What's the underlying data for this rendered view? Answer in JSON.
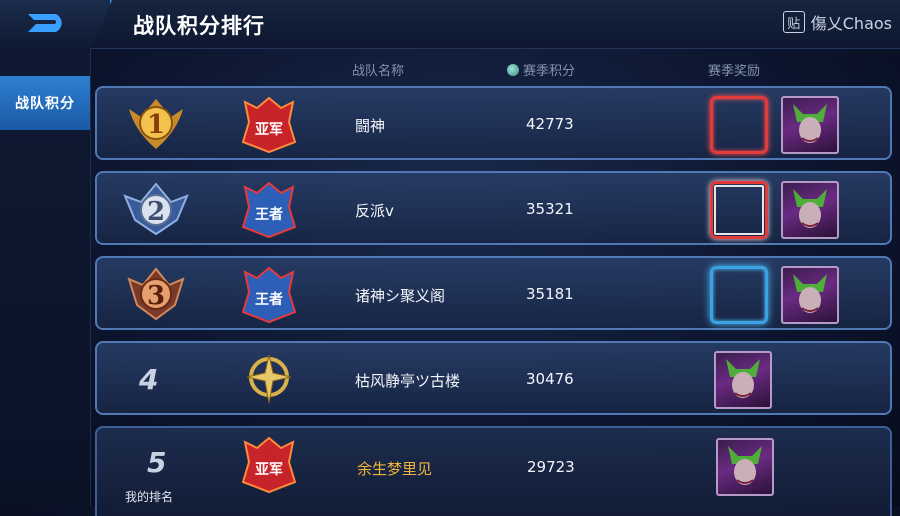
{
  "header": {
    "title": "战队积分排行",
    "brand_glyph": "贴",
    "brand_text": "傷乂Chaos"
  },
  "sidebar": {
    "tab_label": "战队积分"
  },
  "columns": {
    "name": "战队名称",
    "score": "赛季积分",
    "reward": "赛季奖励"
  },
  "rows": [
    {
      "rank": "1",
      "badge": "亚军",
      "name": "闘神",
      "score": "42773",
      "frame": "red"
    },
    {
      "rank": "2",
      "badge": "王者",
      "name": "反派v",
      "score": "35321",
      "frame": "silver"
    },
    {
      "rank": "3",
      "badge": "王者",
      "name": "诸神シ聚义阁",
      "score": "35181",
      "frame": "blue"
    },
    {
      "rank": "4",
      "badge": "",
      "name": "枯风静亭ツ古楼",
      "score": "30476",
      "frame": ""
    }
  ],
  "my_rank": {
    "rank": "5",
    "label": "我的排名",
    "badge": "亚军",
    "name": "余生梦里见",
    "score": "29723"
  },
  "colors": {
    "accent": "#2f7fd1",
    "gold": "#f0b43a",
    "border": "#4f78b4"
  }
}
